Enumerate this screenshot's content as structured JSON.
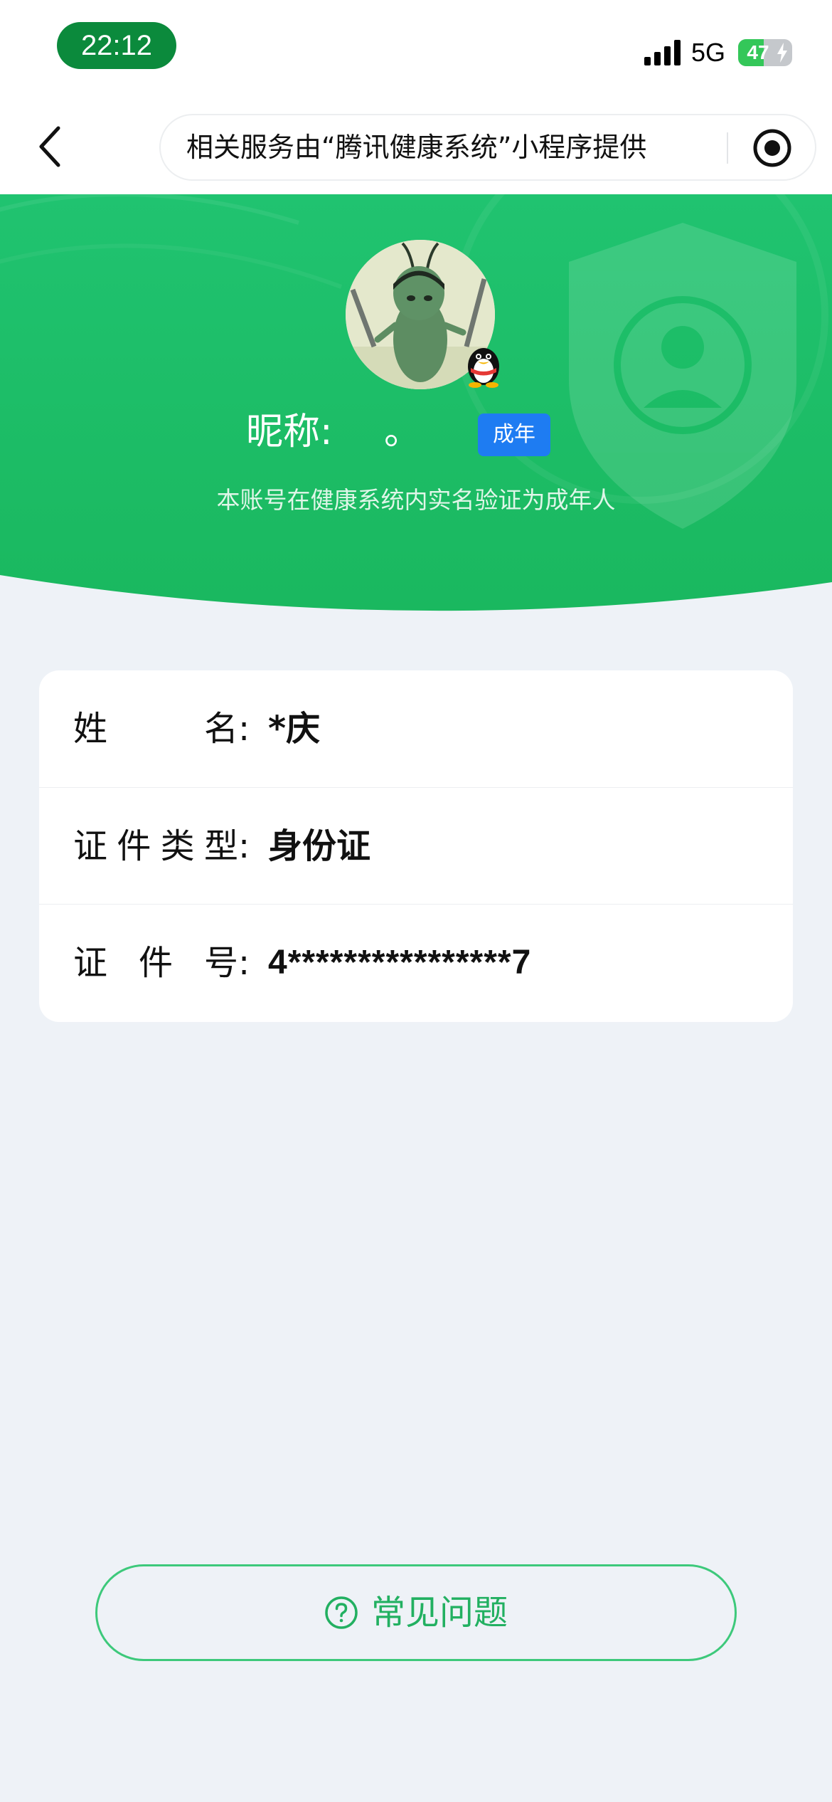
{
  "status_bar": {
    "time": "22:12",
    "network": "5G",
    "battery_level": "47",
    "battery_fraction": 0.47,
    "icons": [
      "signal-icon",
      "charging-icon"
    ]
  },
  "nav": {
    "back_icon": "chevron-left-icon",
    "service_text": "相关服务由“腾讯健康系统”小程序提供",
    "close_icon": "target-icon"
  },
  "profile": {
    "nickname_label": "昵称:",
    "nickname_value": "。",
    "age_badge": "成年",
    "description": "本账号在健康系统内实名验证为成年人",
    "badge_icon": "qq-penguin-icon",
    "avatar_icon": "cartoon-avatar-icon"
  },
  "info": {
    "rows": [
      {
        "label": "姓名",
        "colon": ":",
        "value": "*庆"
      },
      {
        "label": "证件类型",
        "colon": ":",
        "value": "身份证"
      },
      {
        "label": "证件号",
        "colon": ":",
        "value": "4****************7"
      }
    ]
  },
  "faq": {
    "label": "常见问题",
    "icon": "question-circle-icon"
  },
  "colors": {
    "brand_green": "#1fbf66",
    "badge_blue": "#1e7cf2",
    "page_bg": "#eef2f7"
  }
}
